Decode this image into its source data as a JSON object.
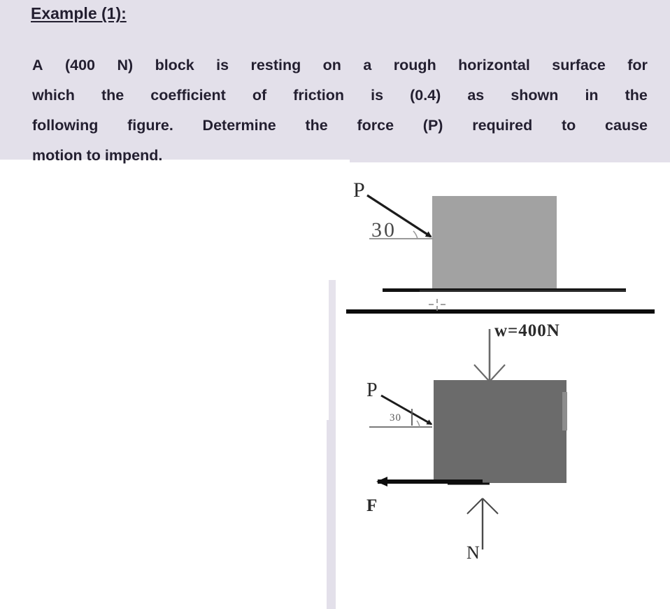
{
  "page": {
    "background_color": "#e3e0ea",
    "panel_color": "#ffffff"
  },
  "header": {
    "title": "Example (1):"
  },
  "problem": {
    "line1_left": "A",
    "line1_parts": [
      "A",
      "(400",
      "N)",
      "block",
      "is",
      "resting",
      "on",
      "a",
      "rough",
      "horizontal",
      "surface",
      "for"
    ],
    "line2_parts": [
      "which",
      "the",
      "coefficient",
      "of",
      "friction",
      "is",
      "(0.4)",
      "as",
      "shown",
      "in",
      "the"
    ],
    "line3_parts": [
      "following",
      "figure.",
      "Determine",
      "the",
      "force",
      "(P)",
      "required",
      "to",
      "cause"
    ],
    "line4": "motion to impend.",
    "full_text": "A (400 N) block is resting on a rough horizontal surface for which the coefficient of friction is (0.4) as shown in the following figure. Determine the force (P) required to cause motion to impend.",
    "weight_value": "400 N",
    "friction_coefficient": "0.4",
    "force_symbol": "P"
  },
  "figure": {
    "caption_free_body": "free-body-diagram",
    "upper_diagram": {
      "name": "physical-setup",
      "block_color": "#a2a2a2",
      "force_label": "P",
      "angle_label": "30",
      "angle_degrees": 30,
      "ground_line_count": 2
    },
    "lower_diagram": {
      "name": "free-body-diagram",
      "block_color": "#6b6b6b",
      "force_label": "P",
      "angle_label": "30",
      "angle_degrees": 30,
      "weight_label": "w=400N",
      "friction_label": "F",
      "normal_label": "N"
    }
  }
}
